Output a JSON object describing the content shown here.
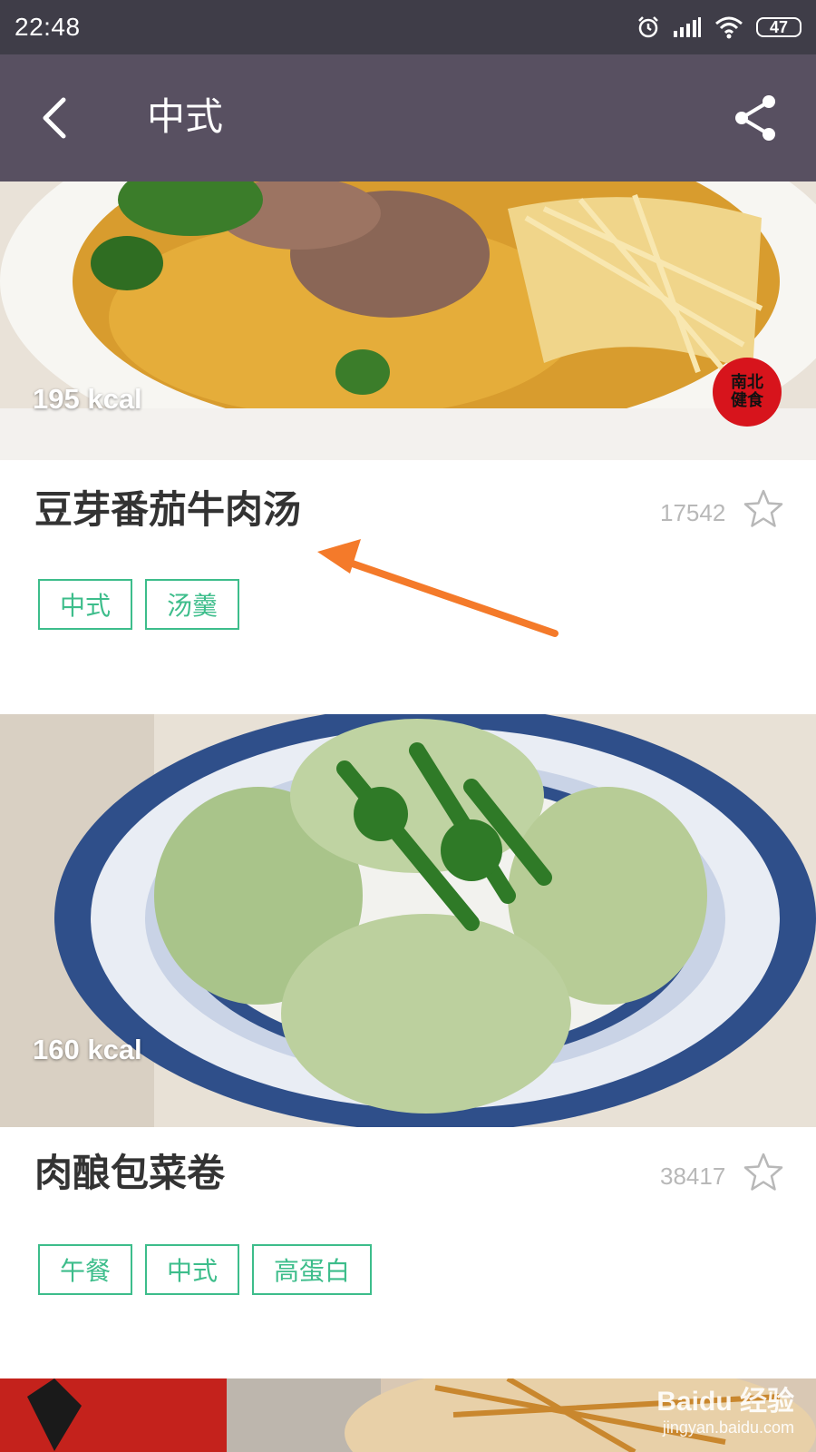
{
  "status_bar": {
    "time": "22:48",
    "battery": "47",
    "icons": [
      "alarm-icon",
      "signal-icon",
      "wifi-icon",
      "battery-icon"
    ]
  },
  "header": {
    "title": "中式",
    "back_icon": "chevron-left-icon",
    "share_icon": "share-icon"
  },
  "recipes": [
    {
      "kcal": "195 kcal",
      "title": "豆芽番茄牛肉汤",
      "favorites": "17542",
      "tags": [
        "中式",
        "汤羹"
      ],
      "logo_text": "南北健食"
    },
    {
      "kcal": "160 kcal",
      "title": "肉酿包菜卷",
      "favorites": "38417",
      "tags": [
        "午餐",
        "中式",
        "高蛋白"
      ]
    }
  ],
  "watermark": {
    "brand": "Baidu 经验",
    "url": "jingyan.baidu.com"
  },
  "colors": {
    "status_bar": "#3f3d48",
    "app_bar": "#585061",
    "tag_accent": "#3dbd8b",
    "arrow": "#f47a2a"
  }
}
